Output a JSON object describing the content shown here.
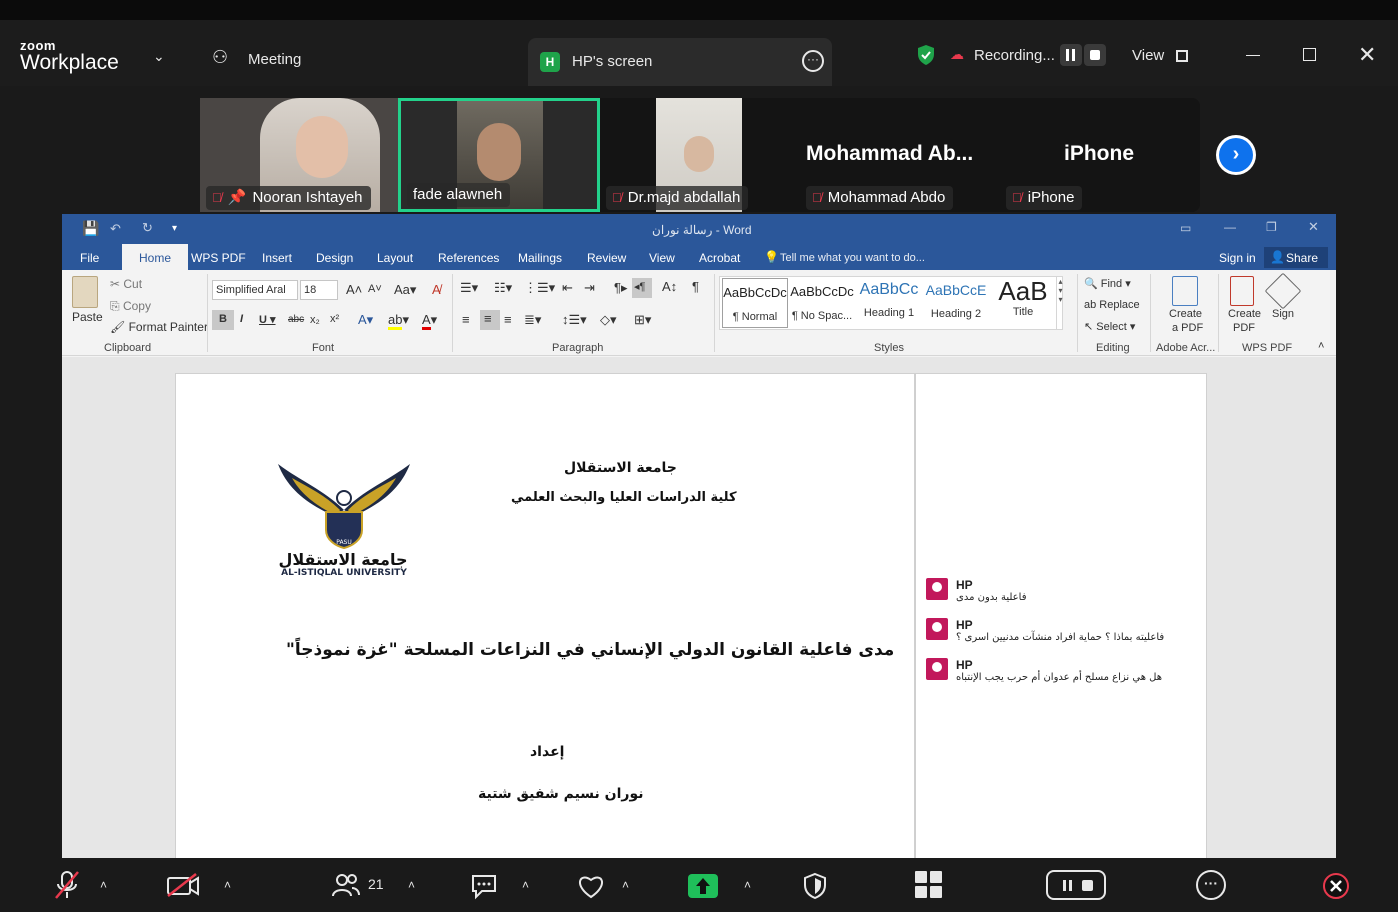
{
  "zoom": {
    "logo_small": "zoom",
    "logo_big": "Workplace",
    "meeting_label": "Meeting",
    "screen_tab_badge": "H",
    "screen_tab_label": "HP's screen",
    "recording_label": "Recording...",
    "view_label": "View",
    "shield_color": "#1fa34a"
  },
  "participants": [
    {
      "name": "Nooran Ishtayeh",
      "muted": true,
      "pinned": true
    },
    {
      "name": "fade alawneh",
      "muted": false,
      "active": true
    },
    {
      "name": "Dr.majd abdallah",
      "muted": true
    },
    {
      "name": "Mohammad Abdo",
      "display": "Mohammad  Ab...",
      "muted": true
    },
    {
      "name": "iPhone",
      "display": "iPhone",
      "muted": true
    }
  ],
  "word": {
    "title": "رسالة نوران - Word",
    "tabs": [
      "File",
      "Home",
      "WPS PDF",
      "Insert",
      "Design",
      "Layout",
      "References",
      "Mailings",
      "Review",
      "View",
      "Acrobat"
    ],
    "tell_me": "Tell me what you want to do...",
    "sign_in": "Sign in",
    "share": "Share",
    "clipboard": {
      "paste": "Paste",
      "cut": "Cut",
      "copy": "Copy",
      "format_painter": "Format Painter",
      "group": "Clipboard"
    },
    "font": {
      "name": "Simplified Aral",
      "size": "18",
      "group": "Font"
    },
    "paragraph_group": "Paragraph",
    "styles": [
      {
        "preview": "AaBbCcDc",
        "label": "¶ Normal"
      },
      {
        "preview": "AaBbCcDc",
        "label": "¶ No Spac..."
      },
      {
        "preview": "AaBbCc",
        "label": "Heading 1"
      },
      {
        "preview": "AaBbCcE",
        "label": "Heading 2"
      },
      {
        "preview": "AaB",
        "label": "Title"
      }
    ],
    "styles_group": "Styles",
    "editing": {
      "find": "Find",
      "replace": "Replace",
      "select": "Select",
      "group": "Editing"
    },
    "adobe": {
      "create": "Create",
      "pdf": "a PDF",
      "group": "Adobe Acr..."
    },
    "wps": {
      "create": "Create",
      "pdf": "PDF",
      "sign": "Sign",
      "group": "WPS PDF"
    }
  },
  "document": {
    "university": "جامعة الاستقلال",
    "faculty": "كلية الدراسات العليا والبحث العلمي",
    "logo_ar": "جامعة الاستقلال",
    "logo_en": "AL-ISTIQLAL UNIVERSITY",
    "logo_shield": "PASU",
    "thesis_title": "مدى فاعلية القانون الدولي الإنساني في النزاعات المسلحة \"غزة نموذجاً\"",
    "prepared_by": "إعداد",
    "author": "نوران نسيم شفيق شتية"
  },
  "comments": [
    {
      "author": "HP",
      "text": "فاعلية بدون مدى"
    },
    {
      "author": "HP",
      "text": "فاعليته بماذا ؟ حماية افراد منشآت مدنيين  اسرى ؟"
    },
    {
      "author": "HP",
      "text": "هل هي نزاع مسلح أم عدوان أم حرب يجب الإنتباه"
    }
  ],
  "toolbar": {
    "participants_count": "21"
  }
}
